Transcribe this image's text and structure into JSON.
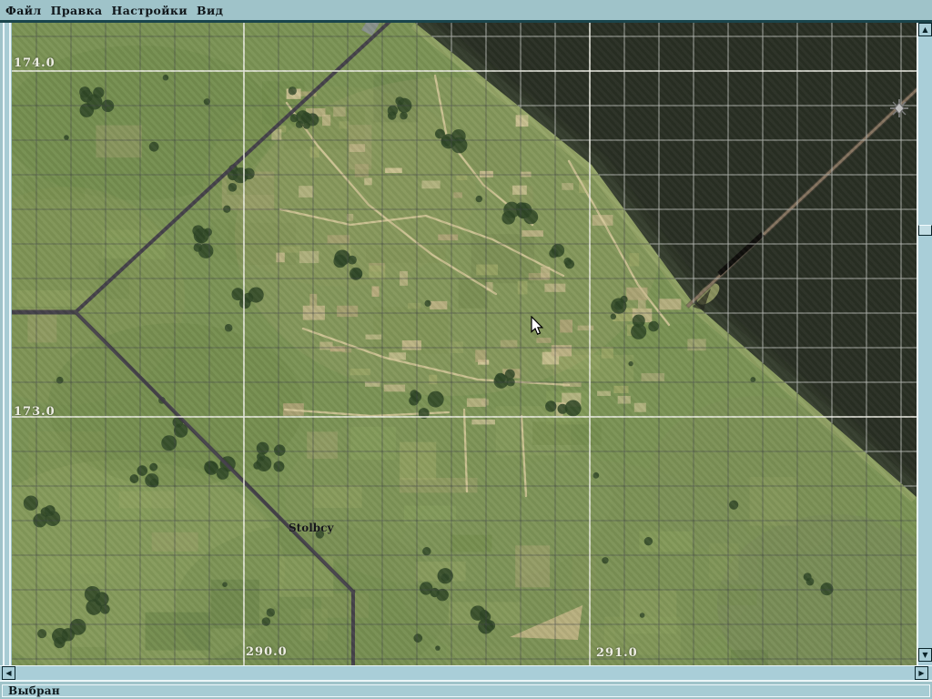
{
  "menu": {
    "items": [
      {
        "label": "Файл"
      },
      {
        "label": "Правка"
      },
      {
        "label": "Настройки"
      },
      {
        "label": "Вид"
      }
    ]
  },
  "map": {
    "grid_labels": {
      "lat_top": "174.0",
      "lat_mid": "173.0",
      "lon_left": "290.0",
      "lon_right": "291.0"
    },
    "town_label": "Stolbcy"
  },
  "statusbar": {
    "text": "Выбран"
  },
  "icons": {
    "up_arrow": "▲",
    "down_arrow": "▼",
    "left_arrow": "◀",
    "right_arrow": "▶"
  },
  "colors": {
    "chrome": "#9fc3c9",
    "chrome_border": "#1a454c",
    "water": "#2c3326",
    "land": "#7b9355",
    "grid_major": "#efefe8"
  }
}
